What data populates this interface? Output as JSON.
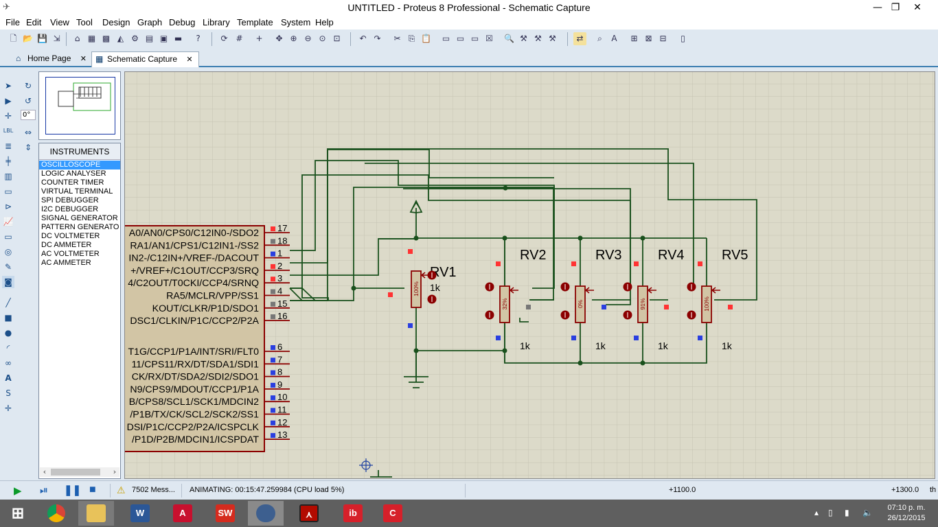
{
  "window": {
    "title": "UNTITLED - Proteus 8 Professional - Schematic Capture"
  },
  "menu": [
    "File",
    "Edit",
    "View",
    "Tool",
    "Design",
    "Graph",
    "Debug",
    "Library",
    "Template",
    "System",
    "Help"
  ],
  "tabs": [
    {
      "label": "Home Page",
      "icon": "home-icon",
      "active": false
    },
    {
      "label": "Schematic Capture",
      "icon": "schematic-icon",
      "active": true
    }
  ],
  "left_tools": {
    "angle": "0°"
  },
  "instruments": {
    "header": "INSTRUMENTS",
    "items": [
      "OSCILLOSCOPE",
      "LOGIC ANALYSER",
      "COUNTER TIMER",
      "VIRTUAL TERMINAL",
      "SPI DEBUGGER",
      "I2C DEBUGGER",
      "SIGNAL GENERATOR",
      "PATTERN GENERATO",
      "DC VOLTMETER",
      "DC AMMETER",
      "AC VOLTMETER",
      "AC AMMETER"
    ],
    "selected": "OSCILLOSCOPE"
  },
  "schematic": {
    "mcu_pins_upper": [
      {
        "label": "A0/AN0/CPS0/C12IN0-/SDO2",
        "num": "17"
      },
      {
        "label": "RA1/AN1/CPS1/C12IN1-/SS2",
        "num": "18"
      },
      {
        "label": "IN2-/C12IN+/VREF-/DACOUT",
        "num": "1"
      },
      {
        "label": "+/VREF+/C1OUT/CCP3/SRQ",
        "num": "2"
      },
      {
        "label": "4/C2OUT/T0CKI/CCP4/SRNQ",
        "num": "3"
      },
      {
        "label": "RA5/MCLR/VPP/SS1",
        "num": "4"
      },
      {
        "label": "KOUT/CLKR/P1D/SDO1",
        "num": "15"
      },
      {
        "label": "DSC1/CLKIN/P1C/CCP2/P2A",
        "num": "16"
      }
    ],
    "mcu_pins_lower": [
      {
        "label": "T1G/CCP1/P1A/INT/SRI/FLT0",
        "num": "6"
      },
      {
        "label": "11/CPS11/RX/DT/SDA1/SDI1",
        "num": "7"
      },
      {
        "label": "CK/RX/DT/SDA2/SDI2/SDO1",
        "num": "8"
      },
      {
        "label": "N9/CPS9/MDOUT/CCP1/P1A",
        "num": "9"
      },
      {
        "label": "B/CPS8/SCL1/SCK1/MDCIN2",
        "num": "10"
      },
      {
        "label": "/P1B/TX/CK/SCL2/SCK2/SS1",
        "num": "11"
      },
      {
        "label": "DSI/P1C/CCP2/P2A/ICSPCLK",
        "num": "12"
      },
      {
        "label": "/P1D/P2B/MDCIN1/ICSPDAT",
        "num": "13"
      }
    ],
    "pots": [
      {
        "ref": "RV1",
        "value": "1k",
        "wiper": "100%"
      },
      {
        "ref": "RV2",
        "value": "1k",
        "wiper": "32%"
      },
      {
        "ref": "RV3",
        "value": "1k",
        "wiper": "0%"
      },
      {
        "ref": "RV4",
        "value": "1k",
        "wiper": "91%"
      },
      {
        "ref": "RV5",
        "value": "1k",
        "wiper": "100%"
      }
    ]
  },
  "status": {
    "messages": "7502 Mess...",
    "animating": "ANIMATING: 00:15:47.259984 (CPU load 5%)",
    "coord_x": "+1100.0",
    "coord_y": "+1300.0",
    "unit": "th"
  },
  "taskbar": {
    "apps": [
      {
        "name": "windows-start",
        "label": ""
      },
      {
        "name": "chrome",
        "label": ""
      },
      {
        "name": "file-explorer",
        "label": ""
      },
      {
        "name": "word",
        "label": "W"
      },
      {
        "name": "autocad",
        "label": "A"
      },
      {
        "name": "solidworks",
        "label": "SW"
      },
      {
        "name": "proteus",
        "label": ""
      },
      {
        "name": "acrobat",
        "label": ""
      },
      {
        "name": "isis",
        "label": "ib"
      },
      {
        "name": "ares",
        "label": "C"
      }
    ],
    "time": "07:10 p. m.",
    "date": "26/12/2015"
  },
  "colors": {
    "wire": "#19501c",
    "component": "#8b0000",
    "sheet": "#dcdac9",
    "grid": "#c8c6b4",
    "selection": "#3399ff"
  }
}
